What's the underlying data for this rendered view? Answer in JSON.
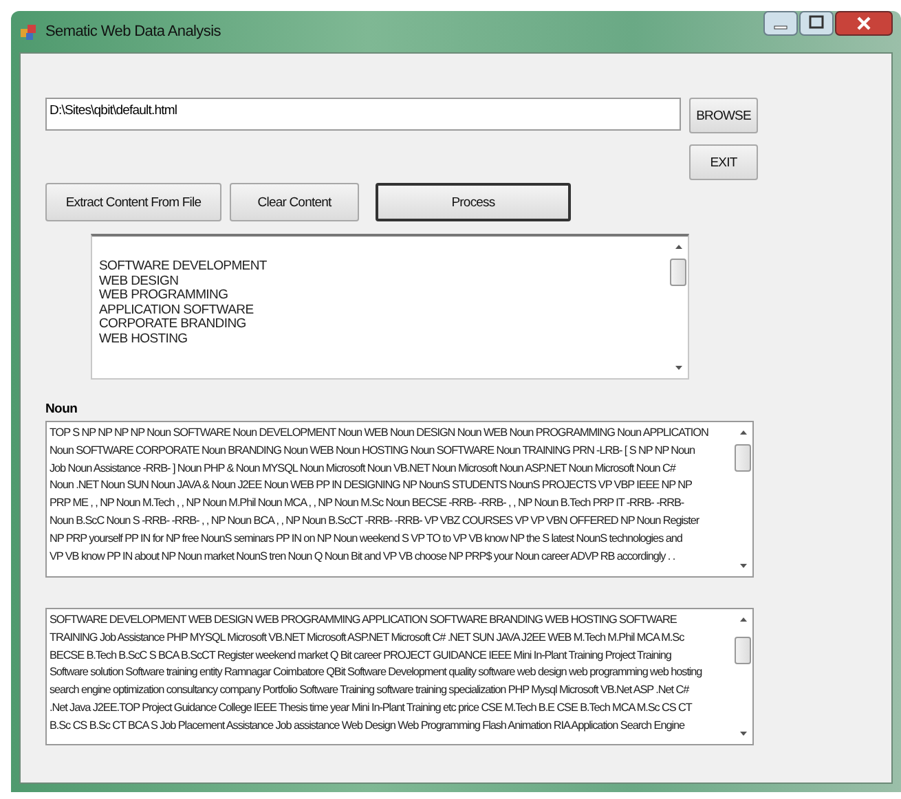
{
  "window": {
    "title": "Sematic Web Data Analysis"
  },
  "path_field": {
    "value": "D:\\Sites\\qbit\\default.html"
  },
  "buttons": [
    {
      "label": "BROWSE",
      "kind": "side"
    },
    {
      "label": "EXIT",
      "kind": "side"
    },
    {
      "label": "Extract Content From File",
      "kind": "action"
    },
    {
      "label": "Clear Content",
      "kind": "action"
    },
    {
      "label": "Process",
      "kind": "default"
    }
  ],
  "content_list": {
    "lines": [
      "SOFTWARE DEVELOPMENT",
      "WEB DESIGN",
      "WEB PROGRAMMING",
      "APPLICATION SOFTWARE",
      "CORPORATE BRANDING",
      "WEB HOSTING"
    ]
  },
  "noun_label": "Noun",
  "noun_box": {
    "lines": [
      "TOP S NP NP NP NP Noun SOFTWARE Noun DEVELOPMENT Noun WEB Noun DESIGN Noun WEB Noun PROGRAMMING Noun APPLICATION",
      "Noun SOFTWARE  CORPORATE Noun BRANDING Noun WEB Noun HOSTING Noun SOFTWARE Noun TRAINING PRN -LRB- [ S NP NP Noun",
      "Job Noun Assistance -RRB- ] Noun PHP  & Noun MYSQL Noun Microsoft Noun VB.NET Noun Microsoft Noun ASP.NET Noun Microsoft Noun C#",
      "Noun .NET Noun SUN Noun JAVA  & Noun J2EE Noun WEB PP IN DESIGNING NP NounS STUDENTS NounS PROJECTS VP VBP IEEE NP NP",
      "PRP ME , , NP Noun M.Tech , , NP Noun M.Phil Noun MCA , , NP Noun M.Sc Noun BECSE -RRB- -RRB- , , NP Noun B.Tech PRP IT -RRB- -RRB-",
      "Noun B.ScC Noun S -RRB- -RRB- , , NP Noun BCA , , NP Noun B.ScCT -RRB- -RRB- VP VBZ COURSES VP VP VBN OFFERED NP Noun Register",
      "NP PRP yourself PP IN for NP  free NounS seminars PP IN on NP Noun weekend S VP TO to VP VB know NP  the S latest NounS technologies  and",
      "VP VB know PP IN about NP Noun market NounS tren Noun Q Noun Bit  and VP VB choose NP PRP$ your Noun career ADVP RB accordingly . ."
    ]
  },
  "keyword_box": {
    "lines": [
      "SOFTWARE DEVELOPMENT WEB DESIGN WEB PROGRAMMING APPLICATION SOFTWARE BRANDING WEB HOSTING SOFTWARE",
      "TRAINING Job Assistance PHP MYSQL Microsoft VB.NET Microsoft ASP.NET Microsoft C# .NET SUN JAVA J2EE WEB M.Tech M.Phil MCA M.Sc",
      "BECSE B.Tech B.ScC S BCA B.ScCT Register weekend market Q Bit career PROJECT GUIDANCE IEEE Mini In-Plant Training Project Training",
      "Software solution Software training entity Ramnagar Coimbatore QBit Software Development quality software web design web programming web hosting",
      "search engine optimization consultancy company Portfolio Software Training software training specialization PHP Mysql Microsoft VB.Net ASP .Net C#",
      ".Net Java J2EE.TOP Project Guidance College IEEE Thesis time year Mini In-Plant Training etc price CSE M.Tech B.E CSE B.Tech MCA M.Sc CS CT",
      "B.Sc CS B.Sc CT BCA S Job Placement Assistance Job assistance Web Design Web Programming Flash Animation RIA Application Search Engine"
    ]
  }
}
